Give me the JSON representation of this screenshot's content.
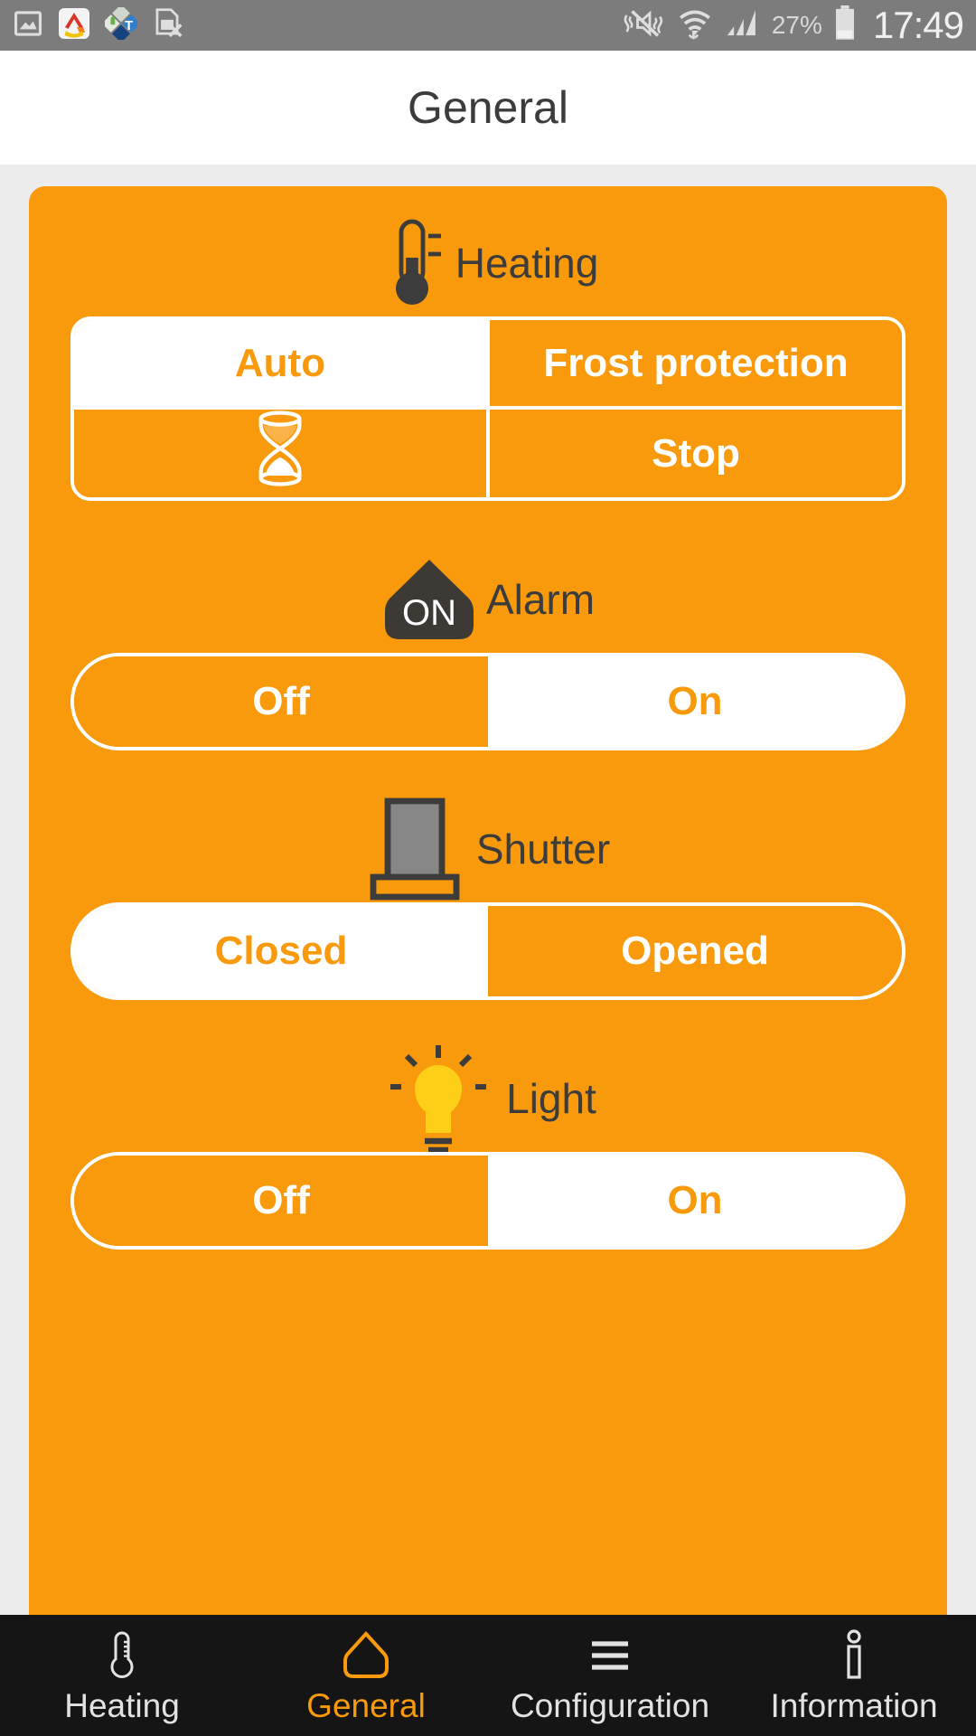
{
  "status_bar": {
    "left_icons": [
      "gallery-image-icon",
      "home-app-icon",
      "android-tc-app-icon",
      "no-sim-card-icon"
    ],
    "right_icons": [
      "mute-vibrate-icon",
      "wifi-icon",
      "cellular-signal-icon",
      "battery-icon"
    ],
    "battery_percent": "27%",
    "clock": "17:49",
    "background": "#7c7c7c"
  },
  "header": {
    "title": "General"
  },
  "theme": {
    "accent": "#f89a0c",
    "card_background": "#f89a0c",
    "page_background": "#ececed",
    "nav_background": "#151515",
    "dark_text": "#3c3c3c",
    "light_text": "#ffffff",
    "bulb_yellow": "#fdd017",
    "shutter_gray": "#878787"
  },
  "sections": [
    {
      "key": "heating",
      "label": "Heating",
      "icon": "thermometer-icon",
      "control_type": "grid",
      "options": [
        {
          "label": "Auto",
          "icon": null,
          "selected": true
        },
        {
          "label": "Frost protection",
          "icon": null,
          "selected": false
        },
        {
          "label": "",
          "icon": "hourglass-icon",
          "selected": false
        },
        {
          "label": "Stop",
          "icon": null,
          "selected": false
        }
      ]
    },
    {
      "key": "alarm",
      "label": "Alarm",
      "icon": "alarm-house-on-icon",
      "icon_text": "ON",
      "control_type": "pill",
      "options": [
        {
          "label": "Off",
          "selected": false
        },
        {
          "label": "On",
          "selected": true
        }
      ]
    },
    {
      "key": "shutter",
      "label": "Shutter",
      "icon": "shutter-icon",
      "control_type": "pill",
      "options": [
        {
          "label": "Closed",
          "selected": true
        },
        {
          "label": "Opened",
          "selected": false
        }
      ]
    },
    {
      "key": "light",
      "label": "Light",
      "icon": "light-bulb-icon",
      "control_type": "pill",
      "options": [
        {
          "label": "Off",
          "selected": false
        },
        {
          "label": "On",
          "selected": true
        }
      ]
    }
  ],
  "bottom_nav": {
    "items": [
      {
        "label": "Heating",
        "icon": "thermometer-outline-icon",
        "active": false
      },
      {
        "label": "General",
        "icon": "home-outline-icon",
        "active": true
      },
      {
        "label": "Configuration",
        "icon": "hamburger-menu-icon",
        "active": false
      },
      {
        "label": "Information",
        "icon": "info-icon",
        "active": false
      }
    ]
  }
}
